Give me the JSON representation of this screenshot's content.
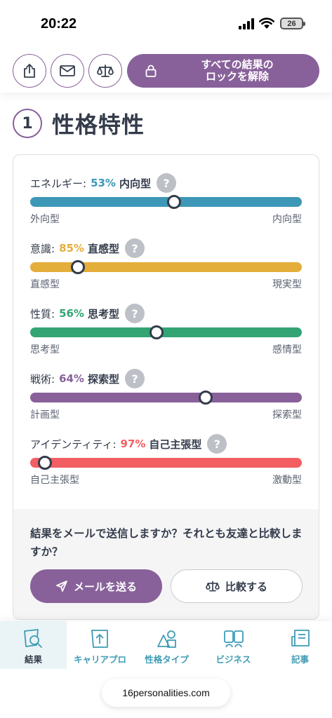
{
  "status_bar": {
    "time": "20:22",
    "battery": "26"
  },
  "toolbar": {
    "unlock_label": "すべての結果の\nロックを解除",
    "icons": [
      "share-icon",
      "mail-icon",
      "compare-scale-icon",
      "lock-icon"
    ]
  },
  "section": {
    "number": "1",
    "title": "性格特性"
  },
  "traits": [
    {
      "name": "エネルギー:",
      "percent": "53%",
      "side": "内向型",
      "left": "外向型",
      "right": "内向型",
      "color": "#3d97b6",
      "position": 0.53
    },
    {
      "name": "意識:",
      "percent": "85%",
      "side": "直感型",
      "left": "直感型",
      "right": "現実型",
      "color": "#e4ae3a",
      "position": 0.175
    },
    {
      "name": "性質:",
      "percent": "56%",
      "side": "思考型",
      "left": "思考型",
      "right": "感情型",
      "color": "#33a474",
      "position": 0.465
    },
    {
      "name": "戦術:",
      "percent": "64%",
      "side": "探索型",
      "left": "計画型",
      "right": "探索型",
      "color": "#88619a",
      "position": 0.645
    },
    {
      "name": "アイデンティティ:",
      "percent": "97%",
      "side": "自己主張型",
      "left": "自己主張型",
      "right": "激動型",
      "color": "#f25e62",
      "position": 0.055
    }
  ],
  "help_mark": "?",
  "footer": {
    "question": "結果をメールで送信しますか？それとも友達と比較しますか？",
    "email_label": "メールを送る",
    "compare_label": "比較する"
  },
  "bottom_nav": {
    "items": [
      {
        "label": "結果",
        "icon": "results-icon"
      },
      {
        "label": "キャリアプロ",
        "icon": "career-icon"
      },
      {
        "label": "性格タイプ",
        "icon": "personality-types-icon"
      },
      {
        "label": "ビジネス",
        "icon": "business-icon"
      },
      {
        "label": "記事",
        "icon": "articles-icon"
      }
    ],
    "url": "16personalities.com"
  }
}
